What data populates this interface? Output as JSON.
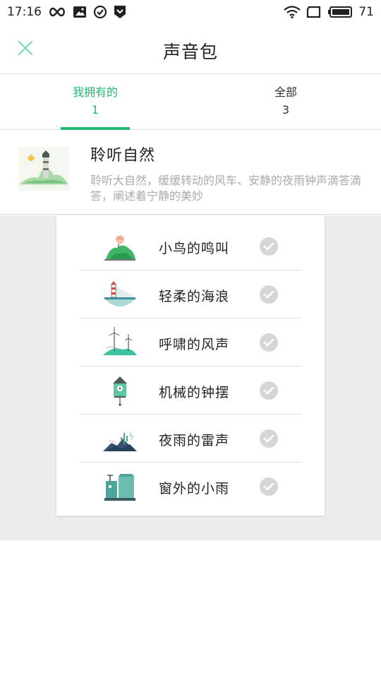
{
  "status_bar": {
    "time": "17:16",
    "battery": "71",
    "icons": [
      "infinity-icon",
      "image-notification-icon",
      "check-circle-icon",
      "shield-icon",
      "wifi-icon",
      "screen-rotate-icon",
      "battery-icon"
    ]
  },
  "header": {
    "title": "声音包",
    "close_icon": "close-icon"
  },
  "colors": {
    "accent": "#1fba70",
    "close": "#7dd8c0",
    "check": "#d3d8d4",
    "description": "#aaaaaa",
    "background_gray": "#ececec"
  },
  "tabs": [
    {
      "label": "我拥有的",
      "count": "1",
      "active": true
    },
    {
      "label": "全部",
      "count": "3",
      "active": false
    }
  ],
  "pack": {
    "title": "聆听自然",
    "description": "聆听大自然，缓缓转动的风车、安静的夜雨钟声滴答滴答，阐述着宁静的美妙",
    "thumbnail": "lighthouse-landscape-icon"
  },
  "sounds": [
    {
      "label": "小鸟的鸣叫",
      "icon": "bird-hill-icon",
      "selected": true
    },
    {
      "label": "轻柔的海浪",
      "icon": "lighthouse-sea-icon",
      "selected": true
    },
    {
      "label": "呼啸的风声",
      "icon": "windmill-icon",
      "selected": true
    },
    {
      "label": "机械的钟摆",
      "icon": "cuckoo-clock-icon",
      "selected": true
    },
    {
      "label": "夜雨的雷声",
      "icon": "night-mountain-icon",
      "selected": true
    },
    {
      "label": "窗外的小雨",
      "icon": "rainy-building-icon",
      "selected": true
    }
  ]
}
